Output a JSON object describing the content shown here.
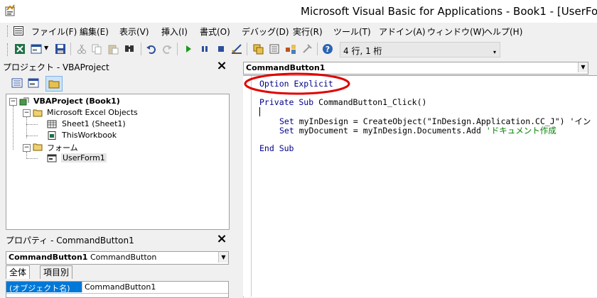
{
  "window": {
    "title": "Microsoft Visual Basic for Applications - Book1 - [UserFor"
  },
  "menubar": {
    "items": [
      "ファイル(F)",
      "編集(E)",
      "表示(V)",
      "挿入(I)",
      "書式(O)",
      "デバッグ(D)",
      "実行(R)",
      "ツール(T)",
      "アドイン(A)",
      "ウィンドウ(W)",
      "ヘルプ(H)"
    ]
  },
  "toolbar": {
    "position": "4 行, 1 桁",
    "icons": [
      "excel-icon",
      "insert-userform-icon",
      "save-icon",
      "cut-icon",
      "copy-icon",
      "paste-icon",
      "find-icon",
      "undo-icon",
      "redo-icon",
      "run-icon",
      "break-icon",
      "reset-icon",
      "design-mode-icon",
      "project-explorer-icon",
      "properties-icon",
      "object-browser-icon",
      "toolbox-icon",
      "help-icon"
    ]
  },
  "project_panel": {
    "title": "プロジェクト - VBAProject",
    "close": "×",
    "tree": {
      "root": "VBAProject (Book1)",
      "folder1": "Microsoft Excel Objects",
      "sheet1": "Sheet1 (Sheet1)",
      "thisworkbook": "ThisWorkbook",
      "folder2": "フォーム",
      "userform1": "UserForm1"
    }
  },
  "properties_panel": {
    "title": "プロパティ - CommandButton1",
    "close": "×",
    "object_name": "CommandButton1",
    "object_type": "CommandButton",
    "tabs": [
      "全体",
      "項目別"
    ],
    "rows": [
      {
        "name": "(オブジェクト名)",
        "value": "CommandButton1"
      }
    ]
  },
  "code_window": {
    "object_combo": "CommandButton1",
    "lines": {
      "l1": "Option Explicit",
      "l2_kw1": "Private Sub",
      "l2_rest": " CommandButton1_Click()",
      "l3_kw": "Set",
      "l3_rest": " myInDesign = CreateObject(\"InDesign.Application.CC_J\") 'イン",
      "l4_kw": "Set",
      "l4_rest": " myDocument = myInDesign.Documents.Add ",
      "l4_cmt": "'ドキュメント作成",
      "l5": "End Sub"
    }
  },
  "annotation": {
    "ellipse_color": "#e00000"
  }
}
